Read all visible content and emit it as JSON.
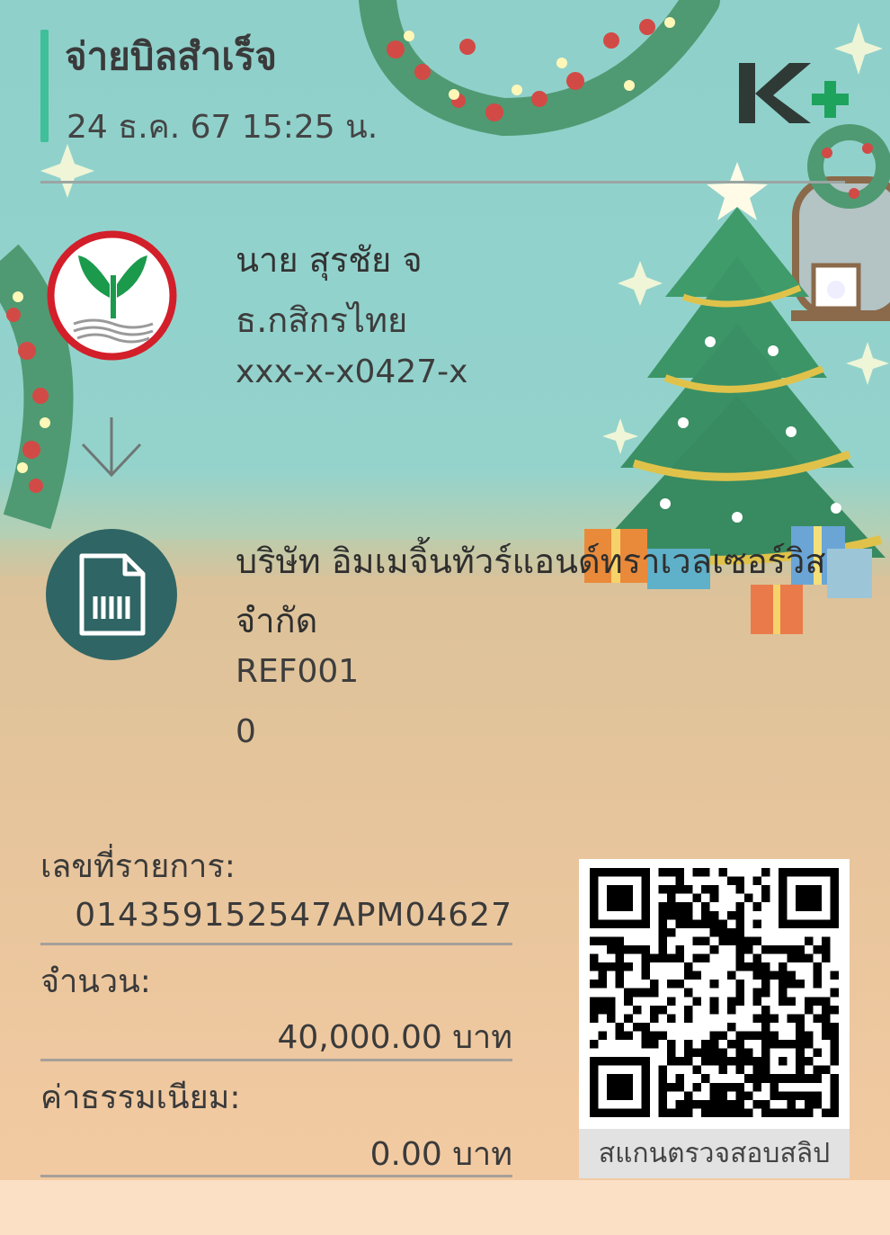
{
  "header": {
    "title": "จ่ายบิลสำเร็จ",
    "datetime": "24 ธ.ค. 67  15:25 น.",
    "logo": "k-plus-logo",
    "accent_color": "#3fbf9a"
  },
  "sender": {
    "icon": "kasikorn-bank-logo-icon",
    "name": "นาย สุรชัย จ",
    "bank": "ธ.กสิกรไทย",
    "account": "xxx-x-x0427-x"
  },
  "transfer_icon": "arrow-down-icon",
  "payee": {
    "icon": "bill-document-icon",
    "name": "บริษัท อิมเมจิ้นทัวร์แอนด์ทราเวลเซอร์วิส จำกัด",
    "ref1": "REF001",
    "ref2": "0"
  },
  "details": {
    "txn_label": "เลขที่รายการ:",
    "txn_value": "014359152547APM04627",
    "amount_label": "จำนวน:",
    "amount_value": "40,000.00 บาท",
    "fee_label": "ค่าธรรมเนียม:",
    "fee_value": "0.00 บาท"
  },
  "qr": {
    "caption": "สแกนตรวจสอบสลิป"
  }
}
